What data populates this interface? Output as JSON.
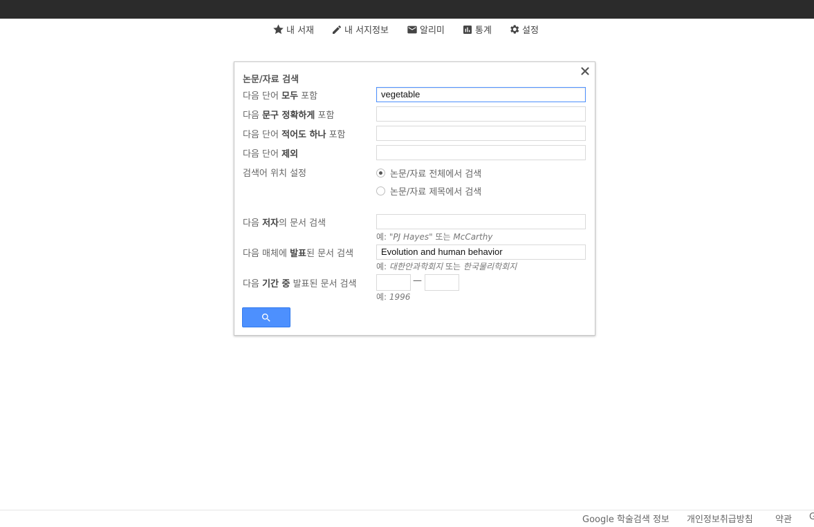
{
  "nav": {
    "items": [
      {
        "label": "내 서재",
        "icon": "star-icon"
      },
      {
        "label": "내 서지정보",
        "icon": "pencil-icon"
      },
      {
        "label": "알리미",
        "icon": "envelope-icon"
      },
      {
        "label": "통계",
        "icon": "chart-icon"
      },
      {
        "label": "설정",
        "icon": "gear-icon"
      }
    ]
  },
  "dialog": {
    "title": "논문/자료 검색",
    "close_icon": "close-icon",
    "all_words": {
      "pre": "다음 단어 ",
      "bold": "모두",
      "post": " 포함",
      "value": "vegetable"
    },
    "exact_phrase": {
      "pre": "다음 ",
      "bold": "문구 정확하게",
      "post": " 포함",
      "value": ""
    },
    "any_words": {
      "pre": "다음 단어 ",
      "bold": "적어도 하나",
      "post": " 포함",
      "value": ""
    },
    "without_words": {
      "pre": "다음 단어 ",
      "bold": "제외",
      "post": "",
      "value": ""
    },
    "location": {
      "label": "검색어 위치 설정",
      "options": [
        "논문/자료 전체에서 검색",
        "논문/자료 제목에서 검색"
      ],
      "selected": 0
    },
    "author": {
      "pre": "다음 ",
      "bold": "저자",
      "post": "의 문서 검색",
      "value": "",
      "hint_prefix": "예: ",
      "hint_a": "\"PJ Hayes\"",
      "hint_mid": " 또는 ",
      "hint_b": "McCarthy"
    },
    "publication": {
      "pre": "다음 매체에 ",
      "bold": "발표",
      "post": "된 문서 검색",
      "value": "Evolution and human behavior",
      "hint_prefix": "예: ",
      "hint_a": "대한안과학회지",
      "hint_mid": " 또는 ",
      "hint_b": "한국물리학회지"
    },
    "date_range": {
      "pre": "다음 ",
      "bold": "기간 중",
      "post": " 발표된 문서 검색",
      "from": "",
      "to": "",
      "separator": "—",
      "hint_prefix": "예: ",
      "hint_a": "1996"
    },
    "search_button_icon": "search-icon"
  },
  "footer": {
    "links": [
      "Google 학술검색 정보",
      "개인정보취급방침",
      "약관",
      "G"
    ]
  },
  "colors": {
    "topbar": "#2b2b2b",
    "accent": "#4d90fe"
  }
}
